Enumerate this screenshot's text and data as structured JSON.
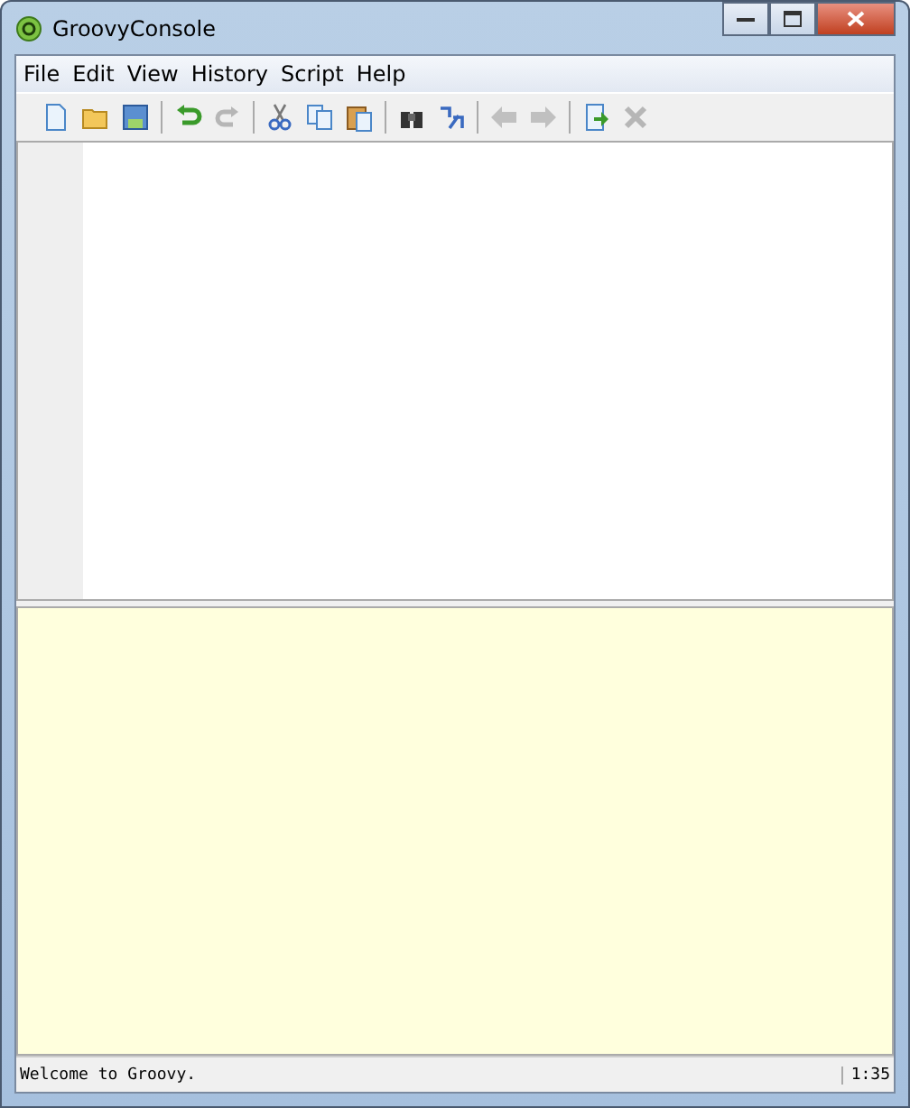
{
  "window": {
    "title": "GroovyConsole"
  },
  "menu": [
    "File",
    "Edit",
    "View",
    "History",
    "Script",
    "Help"
  ],
  "toolbar": [
    {
      "kind": "new",
      "enabled": true
    },
    {
      "kind": "open",
      "enabled": true
    },
    {
      "kind": "save",
      "enabled": true
    },
    {
      "kind": "sep"
    },
    {
      "kind": "undo",
      "enabled": true
    },
    {
      "kind": "redo",
      "enabled": false
    },
    {
      "kind": "sep"
    },
    {
      "kind": "cut",
      "enabled": true
    },
    {
      "kind": "copy",
      "enabled": true
    },
    {
      "kind": "paste",
      "enabled": true
    },
    {
      "kind": "sep"
    },
    {
      "kind": "find",
      "enabled": true
    },
    {
      "kind": "replace",
      "enabled": true
    },
    {
      "kind": "sep"
    },
    {
      "kind": "prev",
      "enabled": false
    },
    {
      "kind": "next",
      "enabled": false
    },
    {
      "kind": "sep"
    },
    {
      "kind": "run",
      "enabled": true
    },
    {
      "kind": "stop",
      "enabled": false
    }
  ],
  "status_bar": {
    "message": "Welcome to Groovy.",
    "position": "1:35"
  }
}
